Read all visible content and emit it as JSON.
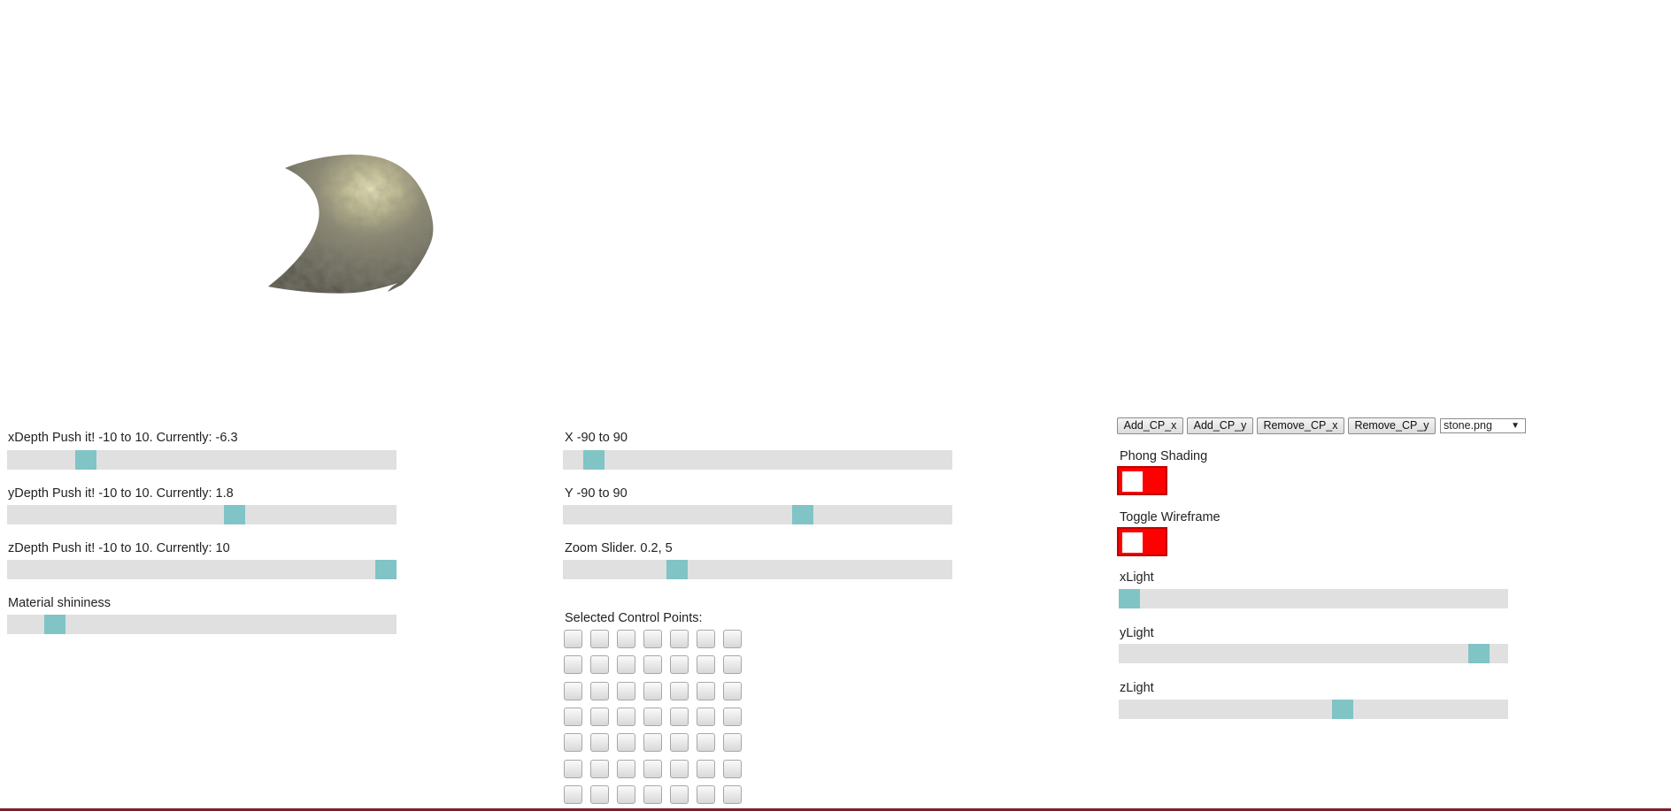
{
  "canvas": {
    "texture": "stone.png"
  },
  "sliders_left": [
    {
      "label": "xDepth Push it! -10 to 10. Currently: -6.3",
      "value": -6.3,
      "min": -10,
      "max": 10
    },
    {
      "label": "yDepth Push it! -10 to 10. Currently: 1.8",
      "value": 1.8,
      "min": -10,
      "max": 10
    },
    {
      "label": "zDepth Push it! -10 to 10. Currently: 10",
      "value": 10,
      "min": -10,
      "max": 10
    },
    {
      "label": "Material shininess",
      "value_fraction": 0.1
    }
  ],
  "sliders_middle": [
    {
      "label": "X -90 to 90",
      "value": -80,
      "min": -90,
      "max": 90
    },
    {
      "label": "Y -90 to 90",
      "value": 22,
      "min": -90,
      "max": 90
    },
    {
      "label": "Zoom Slider. 0.2, 5",
      "value": 1.55,
      "min": 0.2,
      "max": 5
    }
  ],
  "control_points": {
    "label": "Selected Control Points:",
    "rows": 7,
    "cols": 7
  },
  "toolbar": {
    "add_cp_x": "Add_CP_x",
    "add_cp_y": "Add_CP_y",
    "remove_cp_x": "Remove_CP_x",
    "remove_cp_y": "Remove_CP_y",
    "texture_select": "stone.png"
  },
  "toggles": [
    {
      "label": "Phong Shading",
      "on": false
    },
    {
      "label": "Toggle Wireframe",
      "on": false
    }
  ],
  "light_sliders": [
    {
      "label": "xLight",
      "value_fraction": 0.0
    },
    {
      "label": "yLight",
      "value_fraction": 0.95
    },
    {
      "label": "zLight",
      "value_fraction": 0.58
    }
  ],
  "colors": {
    "slider_track": "#e0e0e0",
    "slider_thumb": "#80c4c6",
    "toggle_off": "#ff0000"
  }
}
